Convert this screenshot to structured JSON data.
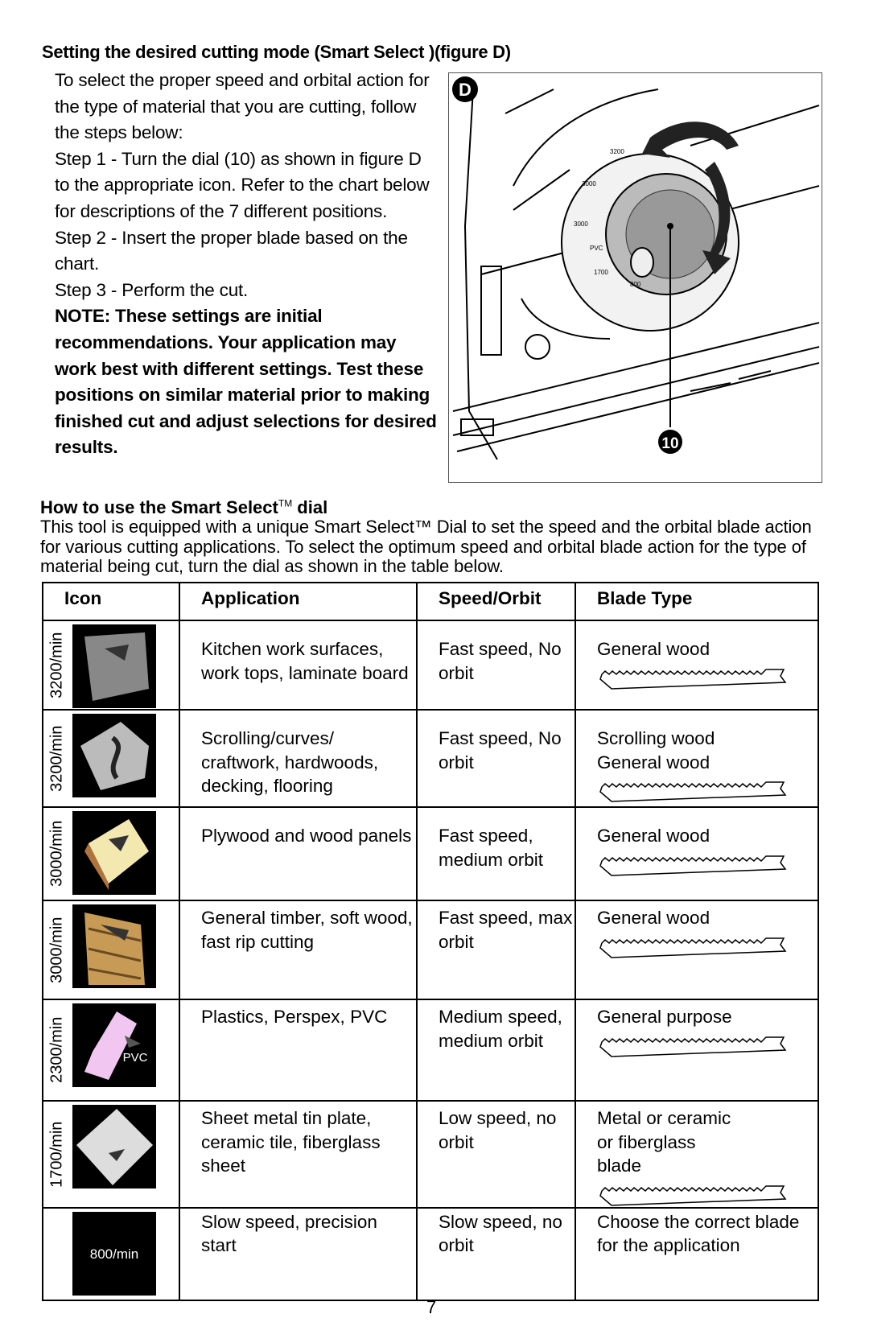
{
  "heading": "Setting the desired cutting mode (Smart Select )(figure D)",
  "intro": [
    "To select the proper speed and orbital action for the type of material that you are cutting, follow the steps below:",
    "Step 1 - Turn the dial (10) as shown in figure D to the appropriate icon. Refer to the chart below for descriptions of the 7 different positions.",
    "Step 2 - Insert the proper blade based on the chart.",
    "Step 3 - Perform the cut."
  ],
  "note": "NOTE: These settings are initial recommendations. Your application may work best with different settings. Test these positions on similar material prior to making finished cut and adjust selections for desired results.",
  "figure": {
    "label": "D",
    "callout": "10",
    "dial_labels": [
      "3200",
      "3200",
      "3000",
      "3000",
      "PVC",
      "1700",
      "800"
    ]
  },
  "section2": {
    "title": "How to use the Smart Select",
    "tm": "TM",
    "title_end": " dial",
    "body": "This tool is equipped with a unique Smart Select™ Dial to set the speed and the orbital blade action for various cutting applications. To select the optimum speed and orbital blade action for the type of material being cut, turn the dial as shown in the table below."
  },
  "table": {
    "headers": [
      "Icon",
      "Application",
      "Speed/Orbit",
      "Blade Type"
    ],
    "rows": [
      {
        "speed": "3200/min",
        "icon": "laminate-icon",
        "application": "Kitchen work surfaces, work tops, laminate board",
        "speed_orbit": "Fast speed, No orbit",
        "blade": "General wood",
        "blade_img": true
      },
      {
        "speed": "3200/min",
        "icon": "scrolling-icon",
        "application": "Scrolling/curves/ craftwork, hardwoods, decking, flooring",
        "speed_orbit": "Fast speed, No orbit",
        "blade": "Scrolling wood General wood",
        "blade_img": true
      },
      {
        "speed": "3000/min",
        "icon": "plywood-icon",
        "application": "Plywood and wood panels",
        "speed_orbit": "Fast speed, medium orbit",
        "blade": "General wood",
        "blade_img": true
      },
      {
        "speed": "3000/min",
        "icon": "timber-icon",
        "application": "General timber, soft wood, fast rip cutting",
        "speed_orbit": "Fast speed, max orbit",
        "blade": "General wood",
        "blade_img": true
      },
      {
        "speed": "2300/min",
        "icon": "pvc-icon",
        "icon_text": "PVC",
        "application": "Plastics, Perspex, PVC",
        "speed_orbit": "Medium speed, medium orbit",
        "blade": "General purpose",
        "blade_img": true
      },
      {
        "speed": "1700/min",
        "icon": "sheet-metal-icon",
        "application": "Sheet metal tin plate, ceramic tile, fiberglass sheet",
        "speed_orbit": "Low speed, no orbit",
        "blade": "Metal or ceramic or fiberglass blade",
        "blade_img": true
      },
      {
        "speed": "",
        "icon": "precision-start-icon",
        "icon_text": "800/min",
        "application": "Slow speed, precision start",
        "speed_orbit": "Slow speed, no orbit",
        "blade": "Choose the correct blade for the application",
        "blade_img": false
      }
    ]
  },
  "page_number": "7"
}
